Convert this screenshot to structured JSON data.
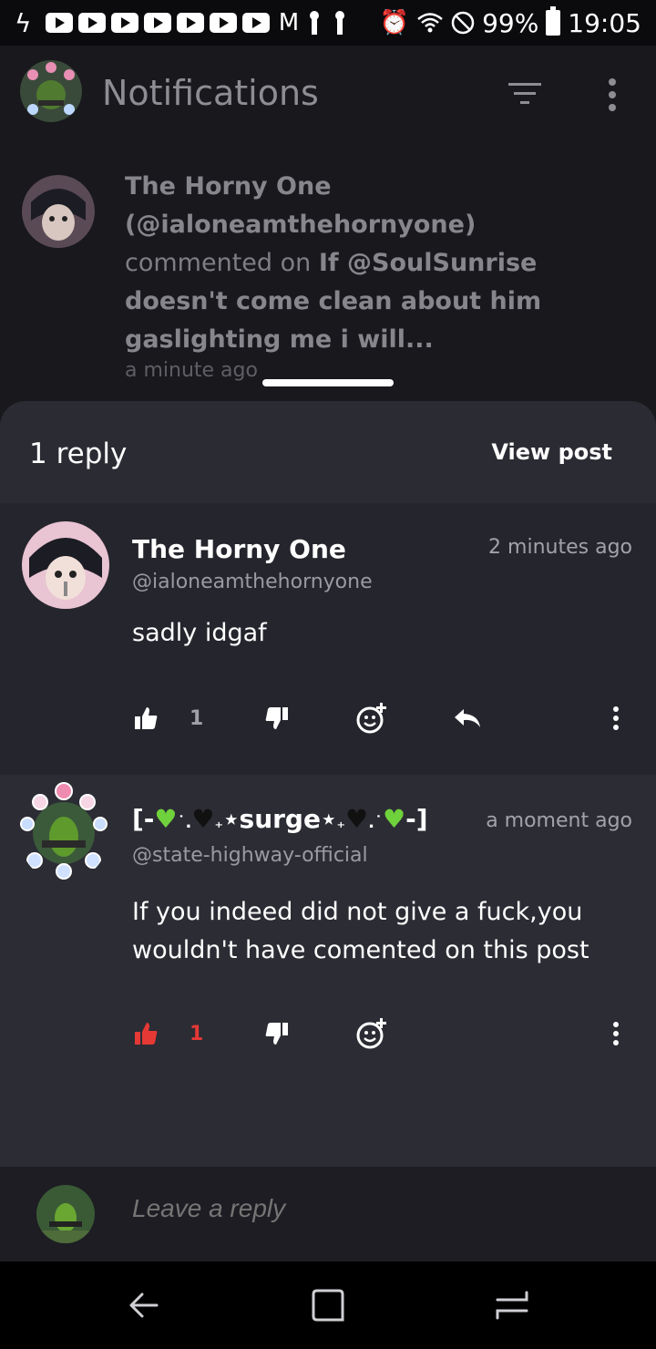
{
  "status_bar": {
    "battery": "99%",
    "time": "19:05"
  },
  "notifications": {
    "title": "Notifications",
    "item": {
      "author": "The Horny One",
      "handle": "(@ialoneamthehornyone)",
      "action": "commented on",
      "post_title": "If @SoulSunrise doesn't come clean about him gaslighting me i will...",
      "time": "a minute ago"
    }
  },
  "sheet": {
    "reply_count": "1 reply",
    "view_post_label": "View post",
    "comments": [
      {
        "name": "The Horny One",
        "handle": "@ialoneamthehornyone",
        "time": "2 minutes ago",
        "body": "sadly idgaf",
        "likes": "1",
        "liked": false
      },
      {
        "name_prefix": "[-",
        "name_surge": "⋆surge⋆",
        "name_suffix": "-]",
        "handle": "@state-highway-official",
        "time": "a moment ago",
        "body": "If you indeed did not give a fuck,you wouldn't have comented on this post",
        "likes": "1",
        "liked": true
      }
    ]
  },
  "reply_bar": {
    "placeholder": "Leave a reply"
  },
  "colors": {
    "accent_like": "#e53935",
    "sheet_bg": "#25252d",
    "header_bg": "#2b2b34"
  }
}
